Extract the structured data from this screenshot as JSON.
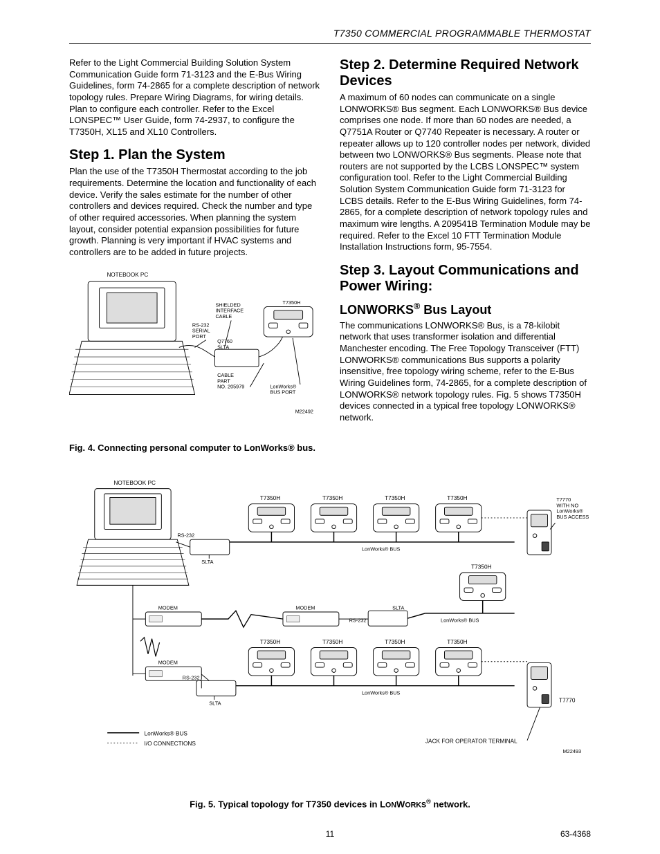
{
  "header": {
    "running": "T7350 COMMERCIAL PROGRAMMABLE THERMOSTAT"
  },
  "left": {
    "intro": "Refer to the Light Commercial Building Solution System Communication Guide form 71-3123 and the E-Bus Wiring Guidelines, form 74-2865 for a complete description of network topology rules. Prepare Wiring Diagrams, for wiring details. Plan to configure each controller. Refer to the Excel LONSPEC™ User Guide, form 74-2937, to configure the T7350H, XL15 and XL10 Controllers.",
    "step1_title": "Step 1. Plan the System",
    "step1_body": "Plan the use of the T7350H Thermostat according to the job requirements. Determine the location and functionality of each device. Verify the sales estimate for the number of other controllers and devices required. Check the number and type of other required accessories. When planning the system layout, consider potential expansion possibilities for future growth. Planning is very important if HVAC systems and controllers are to be added in future projects.",
    "fig4_caption": "Fig. 4. Connecting personal computer to LonWorks® bus."
  },
  "right": {
    "step2_title": "Step 2. Determine Required Network Devices",
    "step2_body": "A maximum of 60 nodes can communicate on a single LONWORKS® Bus segment. Each LONWORKS® Bus device comprises one node. If more than 60 nodes are needed, a Q7751A Router or Q7740 Repeater is necessary. A router or repeater allows up to 120 controller nodes per network, divided between two LONWORKS® Bus segments. Please note that routers are not supported by the LCBS LONSPEC™ system configuration tool. Refer to the Light Commercial Building Solution System Communication Guide form 71-3123 for LCBS details. Refer to the E-Bus Wiring Guidelines, form 74-2865, for a complete description of network topology rules and maximum wire lengths. A 209541B Termination Module may be required. Refer to the Excel 10 FTT Termination Module Installation Instructions form, 95-7554.",
    "step3_title": "Step 3. Layout Communications and Power Wiring:",
    "step3_sub": "LONWORKS® Bus Layout",
    "step3_body": "The communications LONWORKS® Bus, is a 78-kilobit network that uses transformer isolation and differential Manchester encoding. The Free Topology Transceiver (FTT) LONWORKS® communications Bus supports a polarity insensitive, free topology wiring scheme, refer to the E-Bus Wiring Guidelines form, 74-2865, for a complete description of LONWORKS® network topology rules. Fig. 5 shows T7350H devices connected in a typical free topology LONWORKS® network."
  },
  "fig4": {
    "notebook": "NOTEBOOK PC",
    "shielded": "SHIELDED\nINTERFACE\nCABLE",
    "rs232": "RS-232\nSERIAL\nPORT",
    "q7760": "Q7760\nSLTA",
    "cablepart": "CABLE\nPART\nNO. 205979",
    "t7350h": "T7350H",
    "busport": "LonWorks®\nBUS PORT",
    "code": "M22492"
  },
  "fig5": {
    "notebook": "NOTEBOOK PC",
    "t7350h": "T7350H",
    "t7770a": "T7770\nWITH NO\nLonWorks®\nBUS ACCESS",
    "t7770": "T7770",
    "rs232": "RS-232",
    "slta": "SLTA",
    "modem": "MODEM",
    "lwbus": "LonWorks® BUS",
    "legend_bus": "LonWorks® BUS",
    "legend_io": "I/O CONNECTIONS",
    "jack": "JACK FOR OPERATOR TERMINAL",
    "code": "M22493",
    "caption": "Fig. 5. Typical topology for T7350 devices in LONWORKS® network."
  },
  "footer": {
    "page": "11",
    "doc": "63-4368"
  }
}
